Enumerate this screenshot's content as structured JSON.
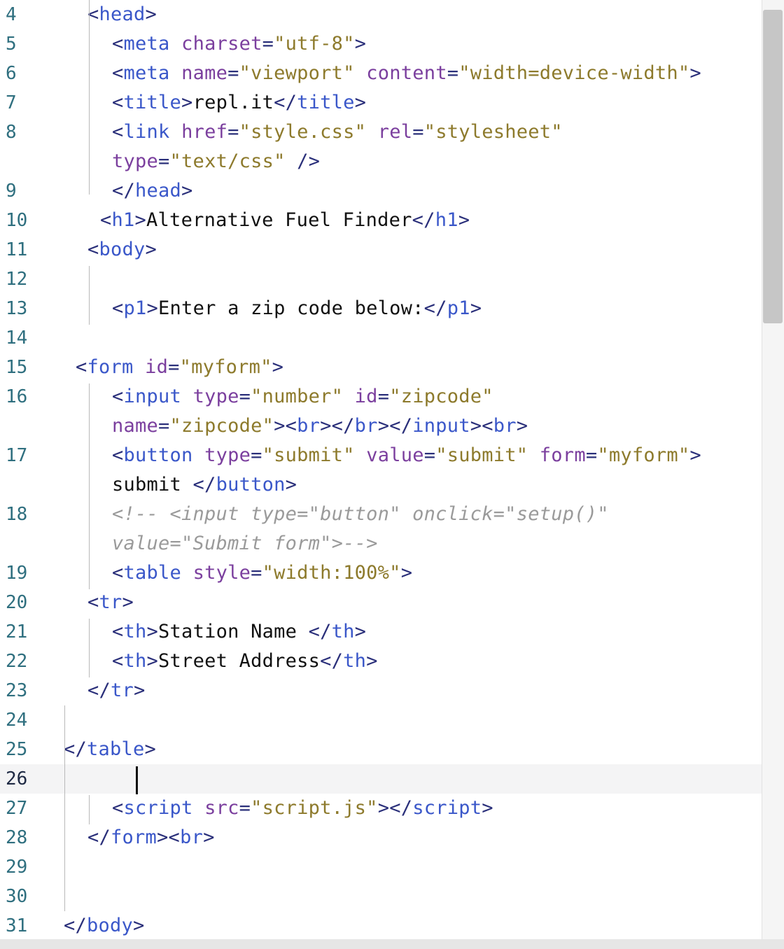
{
  "editor": {
    "active_line": 26,
    "lines": [
      {
        "num": "4",
        "indent": 125,
        "tokens": [
          {
            "t": "<",
            "c": "br"
          },
          {
            "t": "head",
            "c": "tag"
          },
          {
            "t": ">",
            "c": "br"
          }
        ]
      },
      {
        "num": "5",
        "indent": 160,
        "tokens": [
          {
            "t": "<",
            "c": "br"
          },
          {
            "t": "meta",
            "c": "tag"
          },
          {
            "t": " "
          },
          {
            "t": "charset",
            "c": "attr"
          },
          {
            "t": "=",
            "c": "br"
          },
          {
            "t": "\"utf-8\"",
            "c": "str"
          },
          {
            "t": ">",
            "c": "br"
          }
        ]
      },
      {
        "num": "6",
        "indent": 160,
        "tokens": [
          {
            "t": "<",
            "c": "br"
          },
          {
            "t": "meta",
            "c": "tag"
          },
          {
            "t": " "
          },
          {
            "t": "name",
            "c": "attr"
          },
          {
            "t": "=",
            "c": "br"
          },
          {
            "t": "\"viewport\"",
            "c": "str"
          },
          {
            "t": " "
          },
          {
            "t": "content",
            "c": "attr"
          },
          {
            "t": "=",
            "c": "br"
          },
          {
            "t": "\"width=device-width\"",
            "c": "str"
          },
          {
            "t": ">",
            "c": "br"
          }
        ]
      },
      {
        "num": "7",
        "indent": 160,
        "tokens": [
          {
            "t": "<",
            "c": "br"
          },
          {
            "t": "title",
            "c": "tag"
          },
          {
            "t": ">",
            "c": "br"
          },
          {
            "t": "repl.it",
            "c": "text"
          },
          {
            "t": "</",
            "c": "br"
          },
          {
            "t": "title",
            "c": "tag"
          },
          {
            "t": ">",
            "c": "br"
          }
        ]
      },
      {
        "num": "8",
        "indent": 160,
        "tokens": [
          {
            "t": "<",
            "c": "br"
          },
          {
            "t": "link",
            "c": "tag"
          },
          {
            "t": " "
          },
          {
            "t": "href",
            "c": "attr"
          },
          {
            "t": "=",
            "c": "br"
          },
          {
            "t": "\"style.css\"",
            "c": "str"
          },
          {
            "t": " "
          },
          {
            "t": "rel",
            "c": "attr"
          },
          {
            "t": "=",
            "c": "br"
          },
          {
            "t": "\"stylesheet\"",
            "c": "str"
          }
        ]
      },
      {
        "num": "",
        "indent": 160,
        "tokens": [
          {
            "t": "type",
            "c": "attr"
          },
          {
            "t": "=",
            "c": "br"
          },
          {
            "t": "\"text/css\"",
            "c": "str"
          },
          {
            "t": " "
          },
          {
            "t": "/>",
            "c": "br"
          }
        ]
      },
      {
        "num": "9",
        "indent": 160,
        "tokens": [
          {
            "t": "</",
            "c": "br"
          },
          {
            "t": "head",
            "c": "tag"
          },
          {
            "t": ">",
            "c": "br"
          }
        ]
      },
      {
        "num": "10",
        "indent": 143,
        "tokens": [
          {
            "t": "<",
            "c": "br"
          },
          {
            "t": "h1",
            "c": "tag"
          },
          {
            "t": ">",
            "c": "br"
          },
          {
            "t": "Alternative Fuel Finder",
            "c": "text"
          },
          {
            "t": "</",
            "c": "br"
          },
          {
            "t": "h1",
            "c": "tag"
          },
          {
            "t": ">",
            "c": "br"
          }
        ]
      },
      {
        "num": "11",
        "indent": 125,
        "tokens": [
          {
            "t": "<",
            "c": "br"
          },
          {
            "t": "body",
            "c": "tag"
          },
          {
            "t": ">",
            "c": "br"
          }
        ]
      },
      {
        "num": "12",
        "indent": 160,
        "tokens": []
      },
      {
        "num": "13",
        "indent": 160,
        "tokens": [
          {
            "t": "<",
            "c": "br"
          },
          {
            "t": "p1",
            "c": "tag"
          },
          {
            "t": ">",
            "c": "br"
          },
          {
            "t": "Enter a zip code below:",
            "c": "text"
          },
          {
            "t": "</",
            "c": "br"
          },
          {
            "t": "p1",
            "c": "tag"
          },
          {
            "t": ">",
            "c": "br"
          }
        ]
      },
      {
        "num": "14",
        "indent": 160,
        "tokens": []
      },
      {
        "num": "15",
        "indent": 108,
        "tokens": [
          {
            "t": "<",
            "c": "br"
          },
          {
            "t": "form",
            "c": "tag"
          },
          {
            "t": " "
          },
          {
            "t": "id",
            "c": "attr"
          },
          {
            "t": "=",
            "c": "br"
          },
          {
            "t": "\"myform\"",
            "c": "str"
          },
          {
            "t": ">",
            "c": "br"
          }
        ]
      },
      {
        "num": "16",
        "indent": 160,
        "tokens": [
          {
            "t": "<",
            "c": "br"
          },
          {
            "t": "input",
            "c": "tag"
          },
          {
            "t": " "
          },
          {
            "t": "type",
            "c": "attr"
          },
          {
            "t": "=",
            "c": "br"
          },
          {
            "t": "\"number\"",
            "c": "str"
          },
          {
            "t": " "
          },
          {
            "t": "id",
            "c": "attr"
          },
          {
            "t": "=",
            "c": "br"
          },
          {
            "t": "\"zipcode\"",
            "c": "str"
          }
        ]
      },
      {
        "num": "",
        "indent": 160,
        "tokens": [
          {
            "t": "name",
            "c": "attr"
          },
          {
            "t": "=",
            "c": "br"
          },
          {
            "t": "\"zipcode\"",
            "c": "str"
          },
          {
            "t": "><",
            "c": "br"
          },
          {
            "t": "br",
            "c": "tag"
          },
          {
            "t": "></",
            "c": "br"
          },
          {
            "t": "br",
            "c": "tag"
          },
          {
            "t": "></",
            "c": "br"
          },
          {
            "t": "input",
            "c": "tag"
          },
          {
            "t": "><",
            "c": "br"
          },
          {
            "t": "br",
            "c": "tag"
          },
          {
            "t": ">",
            "c": "br"
          }
        ]
      },
      {
        "num": "17",
        "indent": 160,
        "tokens": [
          {
            "t": "<",
            "c": "br"
          },
          {
            "t": "button",
            "c": "tag"
          },
          {
            "t": " "
          },
          {
            "t": "type",
            "c": "attr"
          },
          {
            "t": "=",
            "c": "br"
          },
          {
            "t": "\"submit\"",
            "c": "str"
          },
          {
            "t": " "
          },
          {
            "t": "value",
            "c": "attr"
          },
          {
            "t": "=",
            "c": "br"
          },
          {
            "t": "\"submit\"",
            "c": "str"
          },
          {
            "t": " "
          },
          {
            "t": "form",
            "c": "attr"
          },
          {
            "t": "=",
            "c": "br"
          },
          {
            "t": "\"myform\"",
            "c": "str"
          },
          {
            "t": ">",
            "c": "br"
          }
        ]
      },
      {
        "num": "",
        "indent": 160,
        "tokens": [
          {
            "t": "submit ",
            "c": "text"
          },
          {
            "t": "</",
            "c": "br"
          },
          {
            "t": "button",
            "c": "tag"
          },
          {
            "t": ">",
            "c": "br"
          }
        ]
      },
      {
        "num": "18",
        "indent": 160,
        "tokens": [
          {
            "t": "<!-- <input type=\"button\" onclick=\"setup()\"",
            "c": "cmt"
          }
        ]
      },
      {
        "num": "",
        "indent": 160,
        "tokens": [
          {
            "t": "value=\"Submit form\">-->",
            "c": "cmt"
          }
        ]
      },
      {
        "num": "19",
        "indent": 160,
        "tokens": [
          {
            "t": "<",
            "c": "br"
          },
          {
            "t": "table",
            "c": "tag"
          },
          {
            "t": " "
          },
          {
            "t": "style",
            "c": "attr"
          },
          {
            "t": "=",
            "c": "br"
          },
          {
            "t": "\"width:100%\"",
            "c": "str"
          },
          {
            "t": ">",
            "c": "br"
          }
        ]
      },
      {
        "num": "20",
        "indent": 125,
        "tokens": [
          {
            "t": "<",
            "c": "br"
          },
          {
            "t": "tr",
            "c": "tag"
          },
          {
            "t": ">",
            "c": "br"
          }
        ]
      },
      {
        "num": "21",
        "indent": 160,
        "tokens": [
          {
            "t": "<",
            "c": "br"
          },
          {
            "t": "th",
            "c": "tag"
          },
          {
            "t": ">",
            "c": "br"
          },
          {
            "t": "Station Name ",
            "c": "text"
          },
          {
            "t": "</",
            "c": "br"
          },
          {
            "t": "th",
            "c": "tag"
          },
          {
            "t": ">",
            "c": "br"
          }
        ]
      },
      {
        "num": "22",
        "indent": 160,
        "tokens": [
          {
            "t": "<",
            "c": "br"
          },
          {
            "t": "th",
            "c": "tag"
          },
          {
            "t": ">",
            "c": "br"
          },
          {
            "t": "Street Address",
            "c": "text"
          },
          {
            "t": "</",
            "c": "br"
          },
          {
            "t": "th",
            "c": "tag"
          },
          {
            "t": ">",
            "c": "br"
          }
        ]
      },
      {
        "num": "23",
        "indent": 125,
        "tokens": [
          {
            "t": "</",
            "c": "br"
          },
          {
            "t": "tr",
            "c": "tag"
          },
          {
            "t": ">",
            "c": "br"
          }
        ]
      },
      {
        "num": "24",
        "indent": 125,
        "tokens": []
      },
      {
        "num": "25",
        "indent": 91,
        "tokens": [
          {
            "t": "</",
            "c": "br"
          },
          {
            "t": "table",
            "c": "tag"
          },
          {
            "t": ">",
            "c": "br"
          }
        ]
      },
      {
        "num": "26",
        "indent": 91,
        "tokens": []
      },
      {
        "num": "27",
        "indent": 160,
        "tokens": [
          {
            "t": "<",
            "c": "br"
          },
          {
            "t": "script",
            "c": "tag"
          },
          {
            "t": " "
          },
          {
            "t": "src",
            "c": "attr"
          },
          {
            "t": "=",
            "c": "br"
          },
          {
            "t": "\"script.js\"",
            "c": "str"
          },
          {
            "t": "></",
            "c": "br"
          },
          {
            "t": "script",
            "c": "tag"
          },
          {
            "t": ">",
            "c": "br"
          }
        ]
      },
      {
        "num": "28",
        "indent": 125,
        "tokens": [
          {
            "t": "</",
            "c": "br"
          },
          {
            "t": "form",
            "c": "tag"
          },
          {
            "t": "><",
            "c": "br"
          },
          {
            "t": "br",
            "c": "tag"
          },
          {
            "t": ">",
            "c": "br"
          }
        ]
      },
      {
        "num": "29",
        "indent": 91,
        "tokens": []
      },
      {
        "num": "30",
        "indent": 91,
        "tokens": []
      },
      {
        "num": "31",
        "indent": 91,
        "tokens": [
          {
            "t": "</",
            "c": "br"
          },
          {
            "t": "body",
            "c": "tag"
          },
          {
            "t": ">",
            "c": "br"
          }
        ]
      }
    ]
  },
  "colors": {
    "tag": "#3a57c9",
    "attr": "#7b3f9e",
    "string": "#8d7a2c",
    "comment": "#9a9a9a",
    "line_number": "#2f6f7f",
    "active_line_bg": "#f4f4f5"
  }
}
